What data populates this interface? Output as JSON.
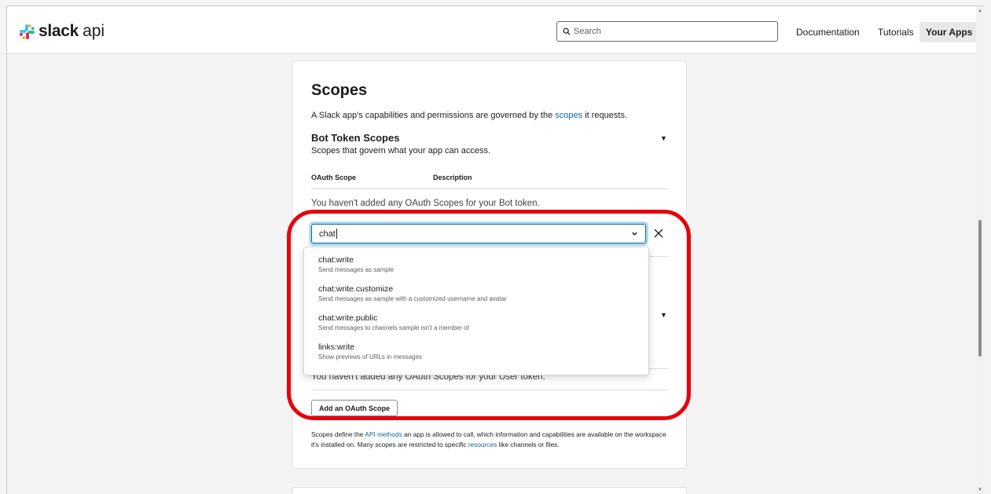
{
  "header": {
    "logo_word": "slack",
    "logo_suffix": "api",
    "search_placeholder": "Search",
    "nav": [
      "Documentation",
      "Tutorials",
      "Your Apps"
    ]
  },
  "scopes": {
    "title": "Scopes",
    "desc_prefix": "A Slack app's capabilities and permissions are governed by the ",
    "desc_link": "scopes",
    "desc_suffix": " it requests.",
    "bot": {
      "title": "Bot Token Scopes",
      "subtitle": "Scopes that govern what your app can access.",
      "col_scope": "OAuth Scope",
      "col_desc": "Description",
      "empty": "You haven't added any OAuth Scopes for your Bot token."
    },
    "combo_value": "chat",
    "options": [
      {
        "name": "chat:write",
        "desc": "Send messages as sample"
      },
      {
        "name": "chat:write.customize",
        "desc": "Send messages as sample with a customized username and avatar"
      },
      {
        "name": "chat:write.public",
        "desc": "Send messages to channels sample isn't a member of"
      },
      {
        "name": "links:write",
        "desc": "Show previews of URLs in messages"
      }
    ],
    "user_empty": "You haven't added any OAuth Scopes for your User token.",
    "add_button": "Add an OAuth Scope",
    "footnote": {
      "p1": "Scopes define the ",
      "link1": "API methods",
      "p2": " an app is allowed to call, which information and capabilities are available on the workspace it's installed on. Many scopes are restricted to specific ",
      "link2": "resources",
      "p3": " like channels or files."
    }
  },
  "colors": {
    "link": "#1264a3",
    "annotation": "#e8000b",
    "focus_ring": "#1d9bd1"
  }
}
